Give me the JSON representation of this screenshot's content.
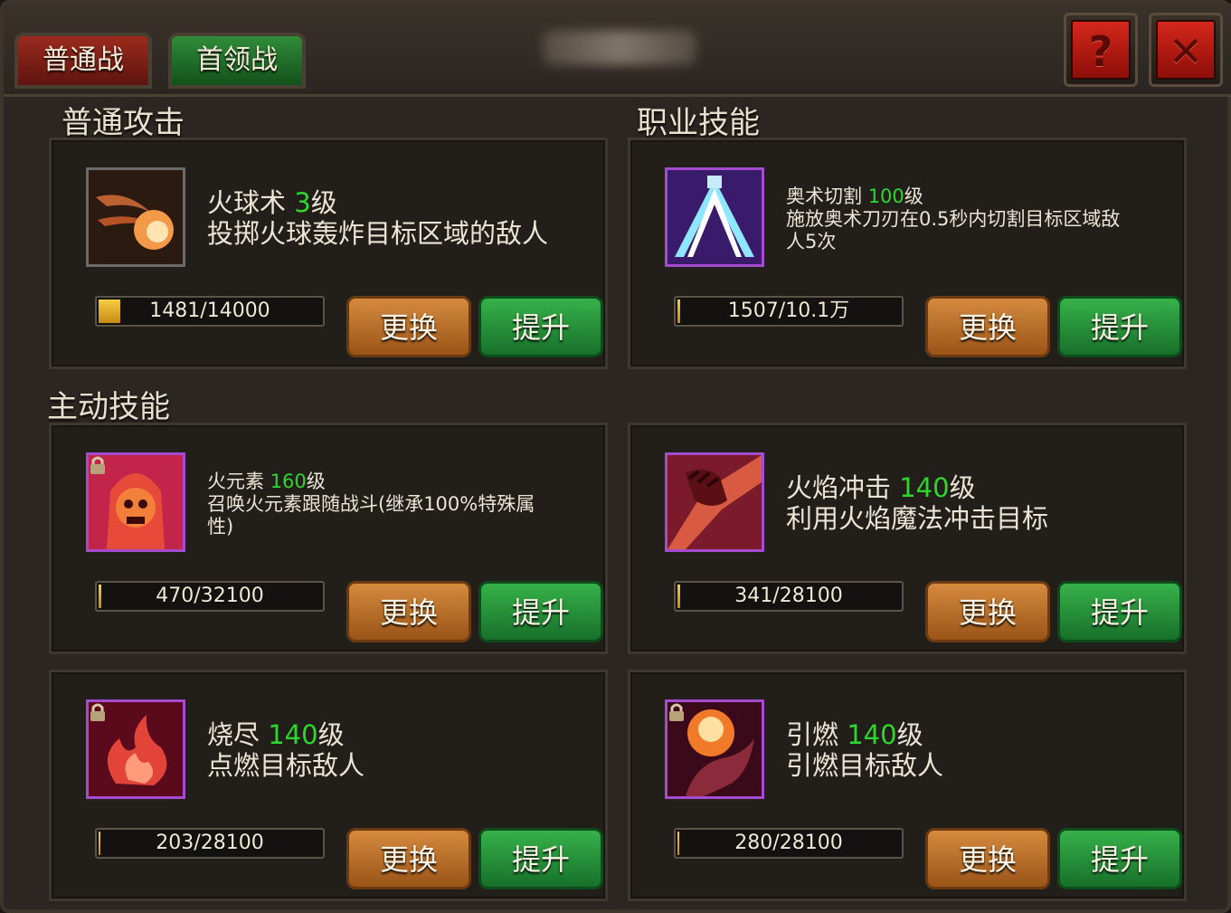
{
  "tabs": [
    {
      "label": "普通战"
    },
    {
      "label": "首领战"
    }
  ],
  "top_buttons": {
    "help": "?",
    "close": "✕"
  },
  "sections": {
    "normal_attack": "普通攻击",
    "class_skill": "职业技能",
    "active_skill": "主动技能"
  },
  "buttons": {
    "swap": "更换",
    "upgrade": "提升"
  },
  "skills": [
    {
      "name": "火球术",
      "level": "3",
      "level_suffix": "级",
      "desc": "投掷火球轰炸目标区域的敌人",
      "progress": "1481/14000",
      "progress_ratio": 0.1058,
      "locked": false,
      "icon": "fireball-icon"
    },
    {
      "name": "奥术切割",
      "level": "100",
      "level_suffix": "级",
      "desc": "施放奥术刀刃在0.5秒内切割目标区域敌人5次",
      "progress": "1507/10.1万",
      "progress_ratio": 0.0149,
      "locked": false,
      "icon": "arcane-slash-icon"
    },
    {
      "name": "火元素",
      "level": "160",
      "level_suffix": "级",
      "desc": "召唤火元素跟随战斗(继承100%特殊属性)",
      "progress": "470/32100",
      "progress_ratio": 0.0146,
      "locked": true,
      "icon": "fire-elemental-icon"
    },
    {
      "name": "火焰冲击",
      "level": "140",
      "level_suffix": "级",
      "desc": "利用火焰魔法冲击目标",
      "progress": "341/28100",
      "progress_ratio": 0.0121,
      "locked": false,
      "icon": "flame-strike-icon"
    },
    {
      "name": "烧尽",
      "level": "140",
      "level_suffix": "级",
      "desc": "点燃目标敌人",
      "progress": "203/28100",
      "progress_ratio": 0.0072,
      "locked": true,
      "icon": "burnout-icon"
    },
    {
      "name": "引燃",
      "level": "140",
      "level_suffix": "级",
      "desc": "引燃目标敌人",
      "progress": "280/28100",
      "progress_ratio": 0.01,
      "locked": true,
      "icon": "ignite-icon"
    }
  ]
}
